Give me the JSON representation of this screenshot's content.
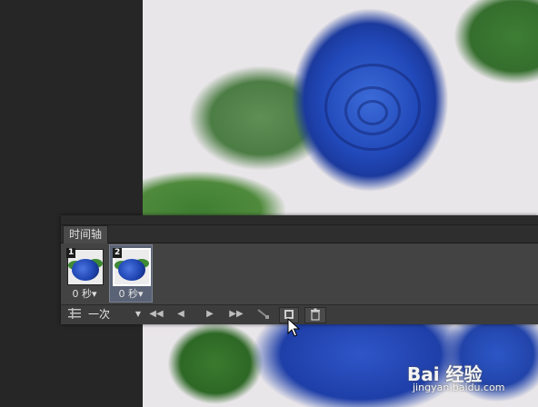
{
  "panel": {
    "tab_label": "时间轴"
  },
  "frames": [
    {
      "number": "1",
      "delay": "0 秒▾",
      "selected": false
    },
    {
      "number": "2",
      "delay": "0 秒▾",
      "selected": true
    }
  ],
  "controls": {
    "loop_value": "一次",
    "loop_arrow": "▼",
    "first_frame": "◀◀",
    "prev_frame": "◀",
    "play": "▶",
    "next_frame": "▶▶"
  },
  "watermark": {
    "logo": "Bai 经验",
    "domain": "jingyan.baidu.com"
  },
  "colors": {
    "rose_blue": "#2148b8",
    "leaf_green": "#3f8a34",
    "panel_bg": "#3a3a3a",
    "selected_frame": "#5a6275"
  }
}
